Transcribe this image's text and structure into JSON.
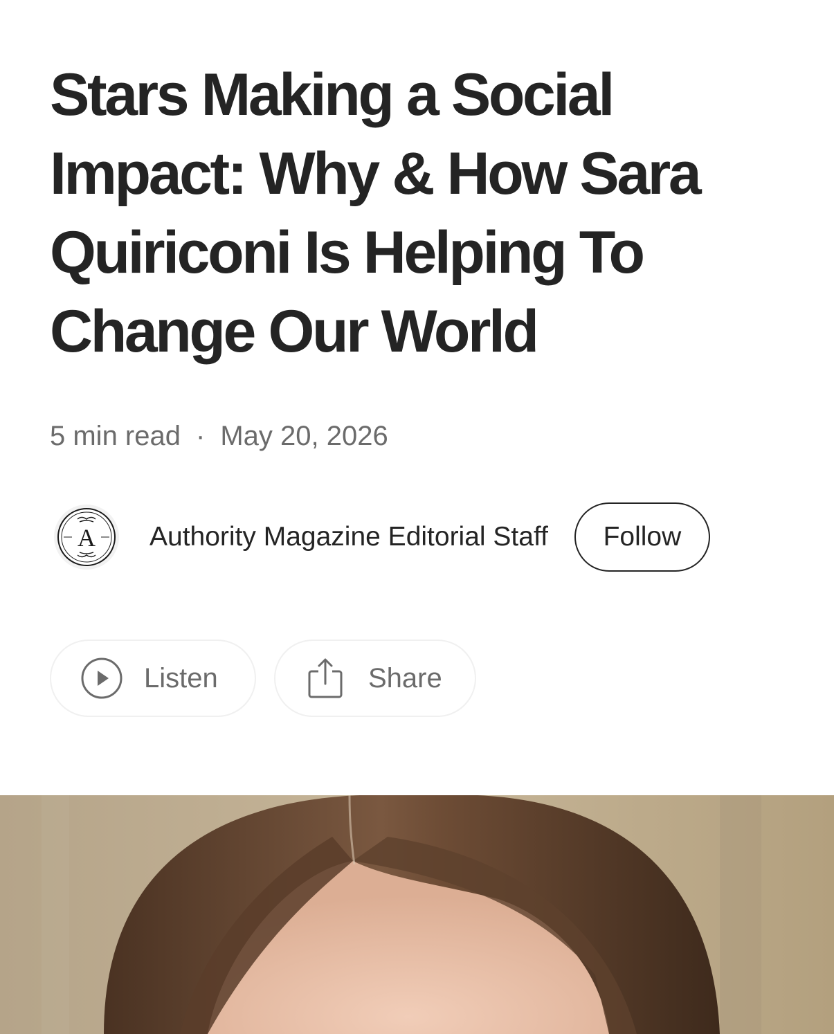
{
  "article": {
    "title": "Stars Making a Social Impact: Why & How Sara Quiriconi Is Helping To Change Our World",
    "read_time": "5 min read",
    "separator": "·",
    "date": "May 20, 2026"
  },
  "author": {
    "name": "Authority Magazine Editorial Staff",
    "avatar_letter": "A",
    "follow_label": "Follow"
  },
  "actions": {
    "listen_label": "Listen",
    "listen_icon": "play-circle-icon",
    "share_label": "Share",
    "share_icon": "share-icon"
  },
  "colors": {
    "text_primary": "#242424",
    "text_secondary": "#6b6b6b",
    "pill_border": "#f0f0f0"
  }
}
